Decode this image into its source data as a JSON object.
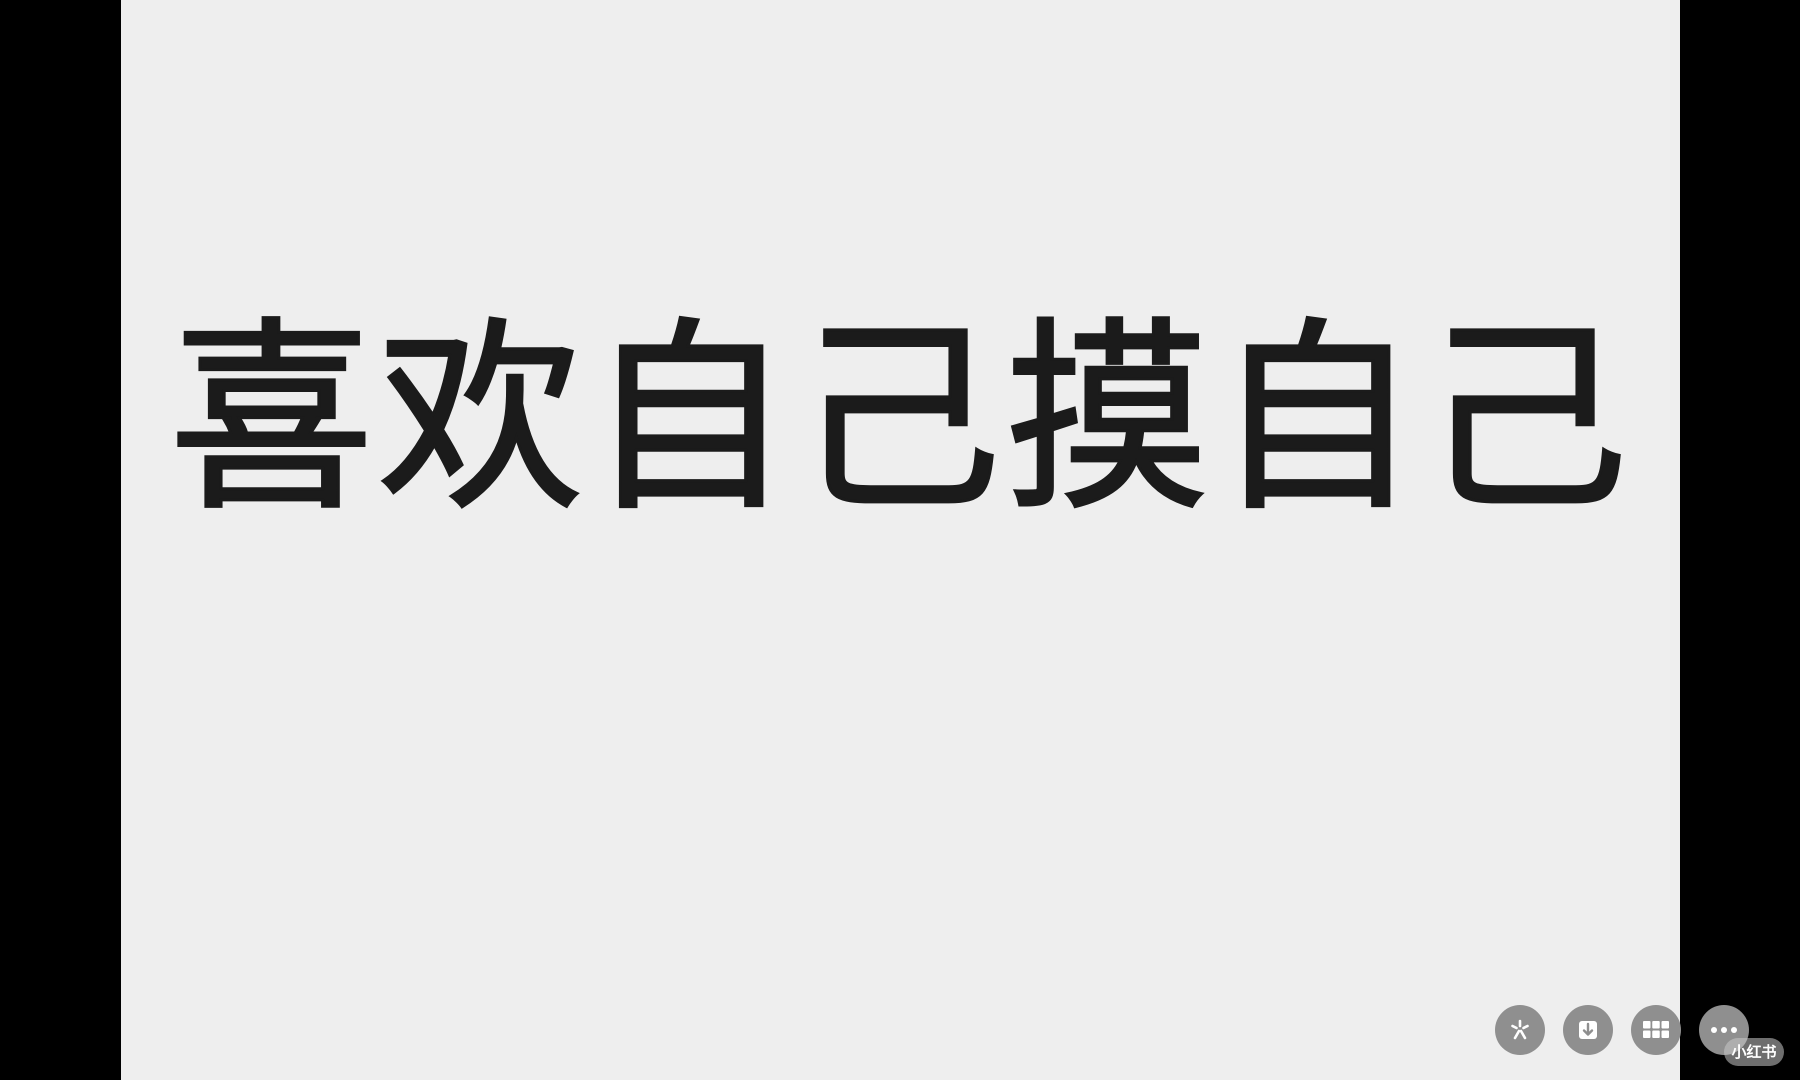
{
  "image": {
    "text": "喜欢自己摸自己",
    "background_color": "#eeeeee",
    "text_color": "#1b1b1b"
  },
  "actions": [
    {
      "name": "sparkle-button",
      "icon": "sparkle-icon"
    },
    {
      "name": "download-button",
      "icon": "download-icon"
    },
    {
      "name": "grid-button",
      "icon": "grid-icon"
    },
    {
      "name": "more-button",
      "icon": "more-icon"
    }
  ],
  "watermark": {
    "text": "小红书"
  },
  "colors": {
    "letterbox": "#000000",
    "button_bg": "#8f8f8f"
  }
}
